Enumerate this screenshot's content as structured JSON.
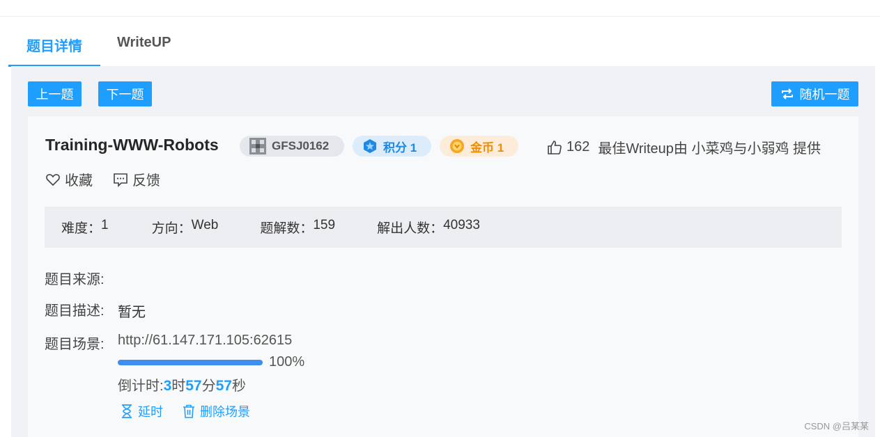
{
  "tabs": [
    {
      "label": "题目详情",
      "active": true
    },
    {
      "label": "WriteUP",
      "active": false
    }
  ],
  "nav": {
    "prev_label": "上一题",
    "next_label": "下一题",
    "random_label": "随机一题"
  },
  "challenge": {
    "title": "Training-WWW-Robots",
    "code": "GFSJ0162",
    "points_label": "积分 1",
    "coins_label": "金币 1",
    "likes": "162",
    "writeup_credit": "最佳Writeup由 小菜鸡与小弱鸡 提供",
    "favorite_label": "收藏",
    "feedback_label": "反馈"
  },
  "stats": [
    {
      "label": "难度：",
      "value": "1"
    },
    {
      "label": "方向：",
      "value": "Web"
    },
    {
      "label": "题解数：",
      "value": "159"
    },
    {
      "label": "解出人数：",
      "value": "40933"
    }
  ],
  "details": {
    "source_label": "题目来源:",
    "source_value": "",
    "desc_label": "题目描述:",
    "desc_value": "暂无",
    "scene_label": "题目场景:",
    "scene_url": "http://61.147.171.105:62615",
    "progress_percent": 100,
    "progress_text": "100%",
    "countdown": {
      "prefix": "倒计时: ",
      "hours": "3",
      "h_unit": "时",
      "minutes": "57",
      "m_unit": "分",
      "seconds": "57",
      "s_unit": "秒"
    },
    "extend_label": "延时",
    "delete_label": "删除场景"
  },
  "watermark": "CSDN @吕某某",
  "colors": {
    "primary": "#1e9fff",
    "points_bg": "#dcecfb",
    "coins_bg": "#fdecd9",
    "coins_text": "#f08c00",
    "panel_bg": "#f1f2f5"
  }
}
